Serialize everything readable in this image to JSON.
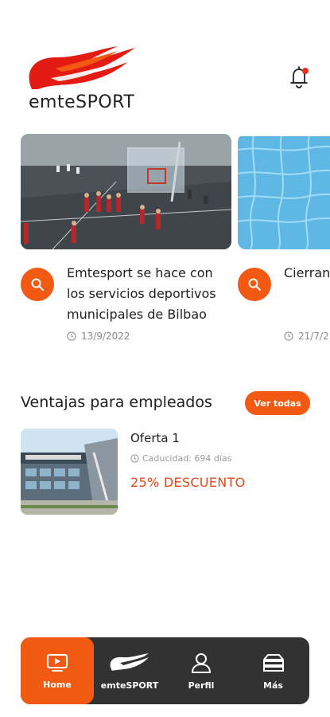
{
  "header": {
    "brand": "emteSPORT",
    "colors": {
      "accent": "#f25a14",
      "brand_red": "#e41b13"
    }
  },
  "news": [
    {
      "title": "Emtesport se hace con los servicios deportivos municipales de Bilbao",
      "date": "13/9/2022",
      "image": "indoor basketball court with youth players"
    },
    {
      "title": "Cierran verano ataque",
      "date": "21/7/2",
      "image": "swimming pool water"
    }
  ],
  "benefits": {
    "title": "Ventajas para empleados",
    "see_all": "Ver todas",
    "offers": [
      {
        "name": "Oferta 1",
        "expiry": "Caducidad: 694 días",
        "discount": "25% DESCUENTO",
        "image": "building facade with sign"
      }
    ]
  },
  "bottom_nav": [
    {
      "label": "Home",
      "icon": "tv-icon",
      "active": true
    },
    {
      "label": "emteSPORT",
      "icon": "emtesport-flame-icon",
      "active": false
    },
    {
      "label": "Perfil",
      "icon": "user-icon",
      "active": false
    },
    {
      "label": "Más",
      "icon": "layers-icon",
      "active": false
    }
  ]
}
